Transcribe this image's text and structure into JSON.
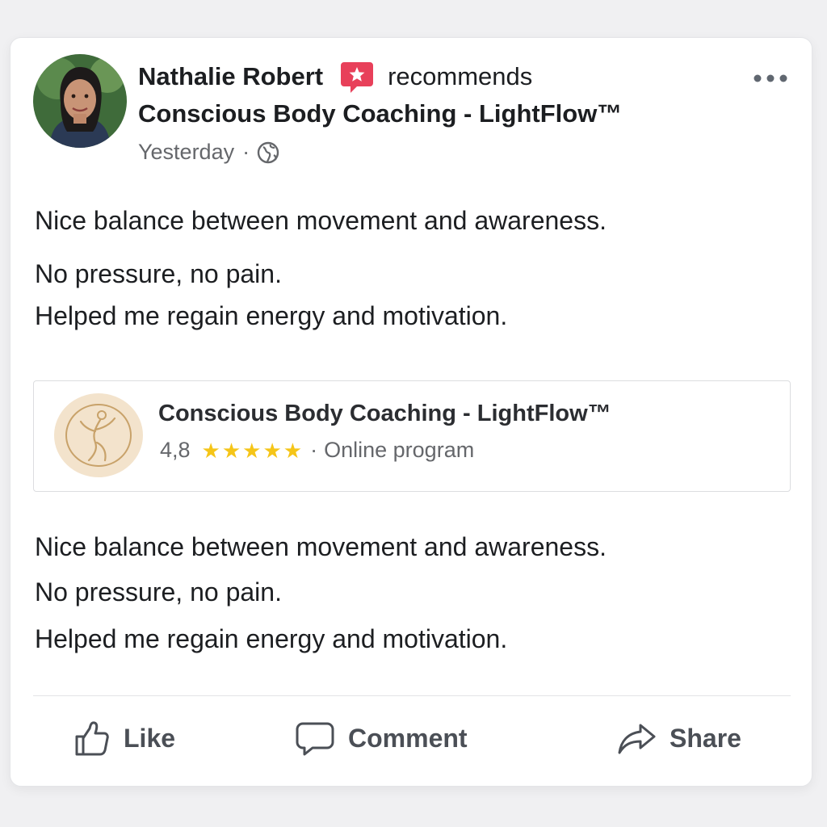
{
  "post": {
    "author": "Nathalie Robert",
    "action_text": "recommends",
    "page_name": "Conscious Body Coaching - LightFlow™",
    "time": "Yesterday",
    "separator": "·",
    "privacy_icon": "globe-icon",
    "more_icon": "more-options-icon",
    "recommend_icon": "recommend-star-icon",
    "text_top": [
      "Nice balance between movement and awareness.",
      "No pressure, no pain.",
      "Helped me regain energy and motivation."
    ],
    "text_bottom": [
      "Nice balance between movement and awareness.",
      "No pressure, no pain.",
      "Helped me regain energy and motivation."
    ]
  },
  "link_card": {
    "title": "Conscious Body Coaching - LightFlow™",
    "rating": "4,8",
    "stars": 5,
    "separator": "·",
    "category": "Online program",
    "logo_icon": "dancer-logo-icon"
  },
  "actions": {
    "like": "Like",
    "comment": "Comment",
    "share": "Share"
  },
  "colors": {
    "accent": "#e8405a",
    "star": "#f5c518",
    "text": "#1c1e21",
    "muted": "#65676b"
  }
}
